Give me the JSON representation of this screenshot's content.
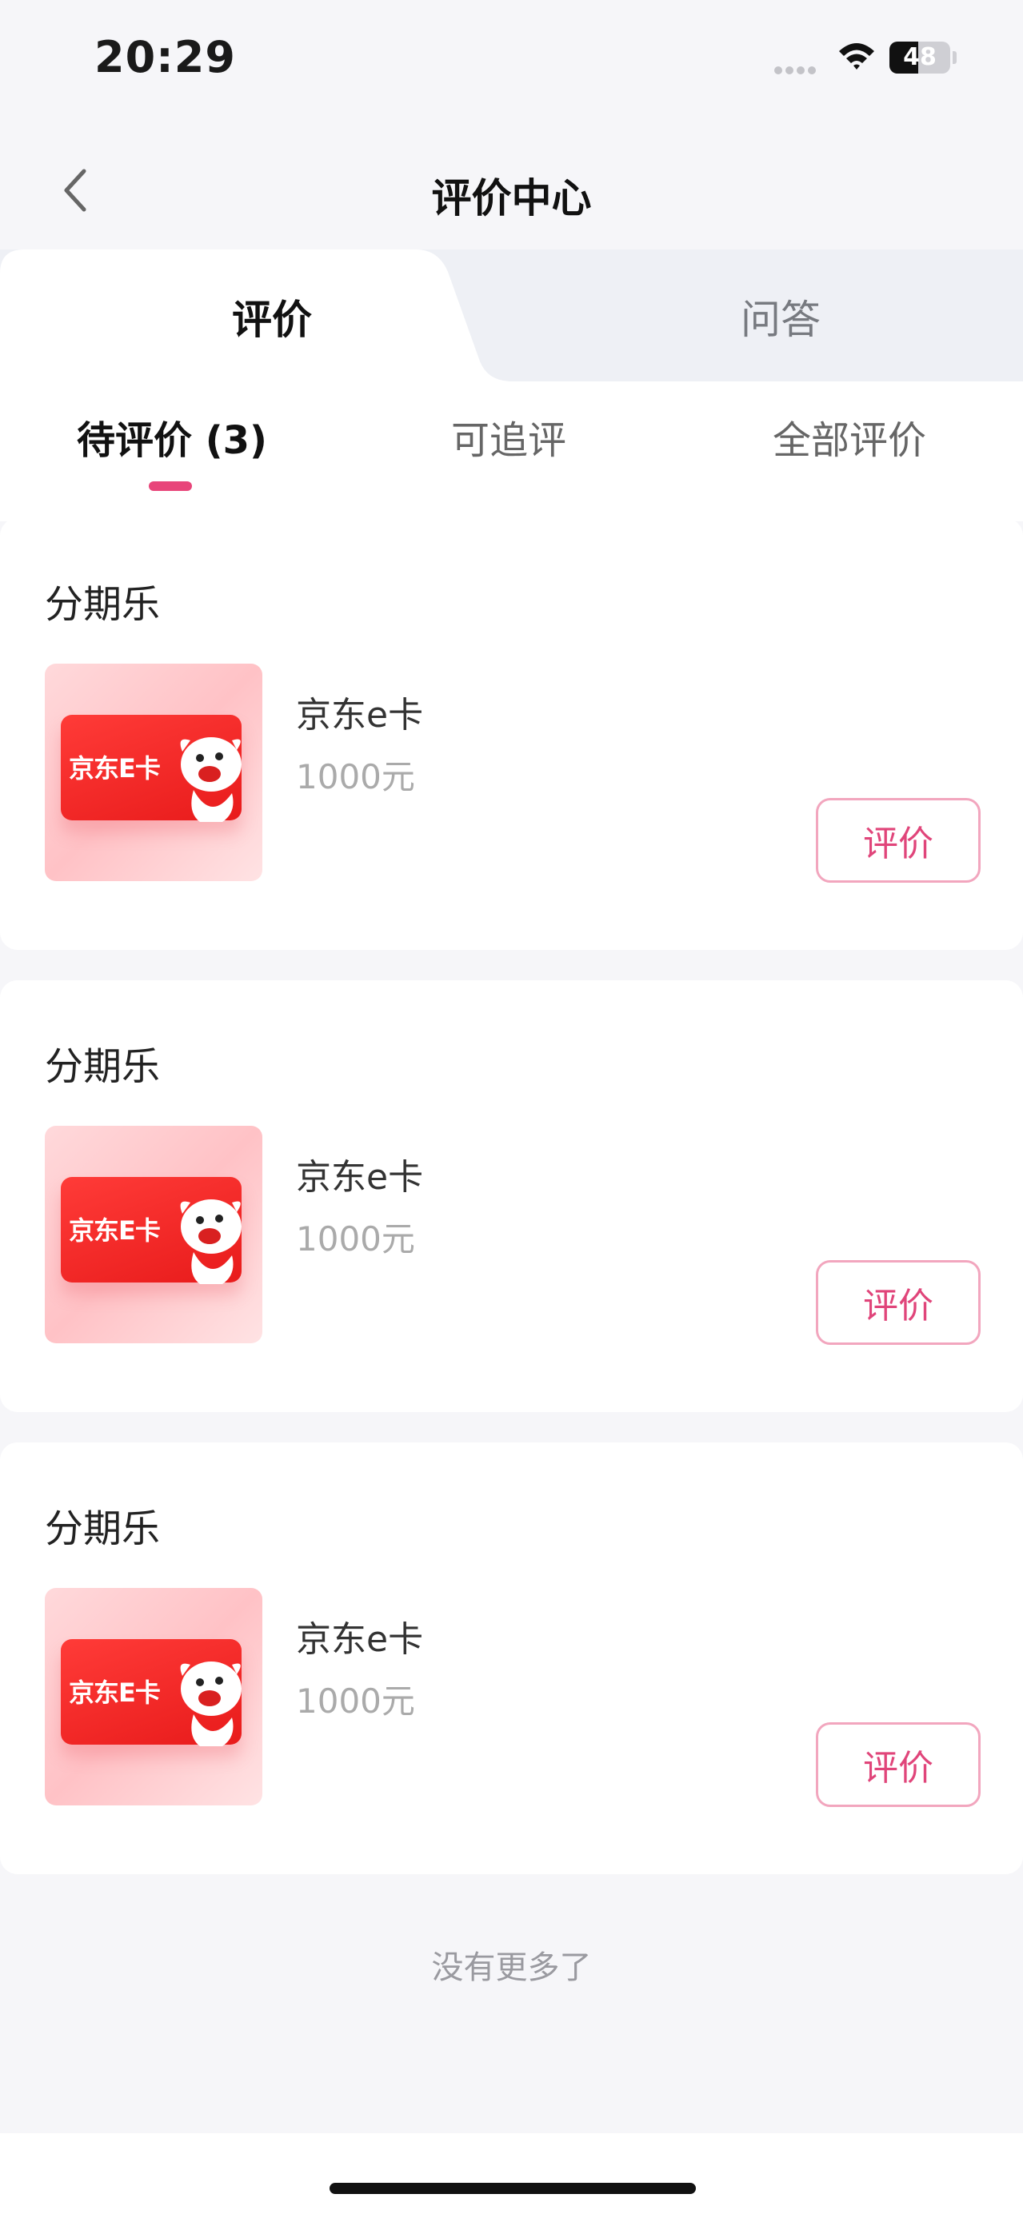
{
  "status_bar": {
    "time": "20:29",
    "battery": "48",
    "battery_level": 0.48
  },
  "nav": {
    "title": "评价中心"
  },
  "top_tabs": [
    {
      "label": "评价",
      "active": true
    },
    {
      "label": "问答",
      "active": false
    }
  ],
  "sub_tabs": [
    {
      "label": "待评价 (3)",
      "active": true
    },
    {
      "label": "可追评",
      "active": false
    },
    {
      "label": "全部评价",
      "active": false
    }
  ],
  "orders": [
    {
      "shop": "分期乐",
      "product": "京东e卡",
      "price": "1000元",
      "action": "评价",
      "thumb_text": "京东E卡"
    },
    {
      "shop": "分期乐",
      "product": "京东e卡",
      "price": "1000元",
      "action": "评价",
      "thumb_text": "京东E卡"
    },
    {
      "shop": "分期乐",
      "product": "京东e卡",
      "price": "1000元",
      "action": "评价",
      "thumb_text": "京东E卡"
    }
  ],
  "footer": {
    "no_more": "没有更多了"
  },
  "colors": {
    "accent": "#e8457a",
    "button_border": "#f2a6be",
    "background": "#f6f6f9"
  }
}
